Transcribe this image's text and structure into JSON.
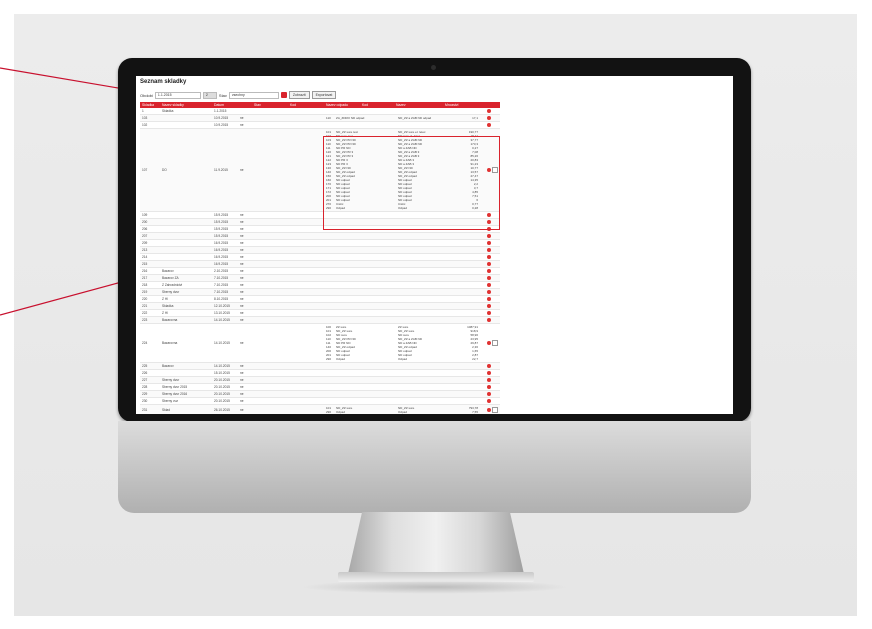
{
  "app": {
    "title": "Seznam skladky"
  },
  "filter": {
    "obdobi_label": "Obdobi",
    "obdobi_value": "1.1.2015",
    "count_value": "2",
    "typ_label": "Stav",
    "typ_value": "vsechny",
    "search_label": "Zobrazit",
    "export_label": "Exportovat"
  },
  "table": {
    "headers": [
      "Skladka",
      "Nazev skladky",
      "Datum",
      "Stav",
      "Kod",
      "Nazev odpadu",
      "Kod",
      "Nazev",
      "Mnozstvi"
    ],
    "rows": [
      {
        "id": "1",
        "name": "Skladka",
        "date": "1.1.2015",
        "flag": "",
        "items": []
      },
      {
        "id": "103",
        "name": "",
        "date": "10.9.2015",
        "flag": "ne",
        "items": [
          {
            "code": "110",
            "name": "ZA_ZDRO ND odpad",
            "cat": "ND_ZZ a ZAB ND odpad",
            "qty": "17,1"
          }
        ]
      },
      {
        "id": "102",
        "name": "",
        "date": "10.9.2015",
        "flag": "ne",
        "items": []
      },
      {
        "id": "107",
        "name": "DO",
        "date": "11.9.2015",
        "flag": "ne",
        "items": [
          {
            "code": "101",
            "name": "ND_ZZ sure text",
            "cat": "ND_ZZ sure el. letec",
            "qty": "190,77"
          },
          {
            "code": "102",
            "name": "ND sure text",
            "cat": "ND sure el. letec",
            "qty": "20,11"
          },
          {
            "code": "103",
            "name": "ND_ZZ PR ND",
            "cat": "ND_ZZ a ZAB ND",
            "qty": "37,77"
          },
          {
            "code": "110",
            "name": "ND_ZZ PR ND",
            "cat": "ND_ZZ a ZAB ND",
            "qty": "173,3"
          },
          {
            "code": "111",
            "name": "ND PR ND",
            "cat": "ND a ZAB ND",
            "qty": "0,27"
          },
          {
            "code": "120",
            "name": "ND_ZZ PR 3",
            "cat": "ND_ZZ a ZAB 3",
            "qty": "7,08"
          },
          {
            "code": "121",
            "name": "ND_ZZ PR 3",
            "cat": "ND_ZZ a ZAB 3",
            "qty": "85,26"
          },
          {
            "code": "122",
            "name": "ND PR 3",
            "cat": "ND a ZAB 3",
            "qty": "20,83"
          },
          {
            "code": "123",
            "name": "ND PR 3",
            "cat": "ND a ZAB 3",
            "qty": "91,23"
          },
          {
            "code": "130",
            "name": "ND_ZZ ND",
            "cat": "ND_ZZ ND",
            "qty": "10,77"
          },
          {
            "code": "140",
            "name": "ND_ZZ odpad",
            "cat": "ND_ZZ odpad",
            "qty": "13,57"
          },
          {
            "code": "150",
            "name": "ND_ZZ odpad",
            "cat": "ND_ZZ odpad",
            "qty": "27,47"
          },
          {
            "code": "160",
            "name": "ND odpad",
            "cat": "ND odpad",
            "qty": "14,35"
          },
          {
            "code": "170",
            "name": "ND odpad",
            "cat": "ND odpad",
            "qty": "2,2"
          },
          {
            "code": "171",
            "name": "ND odpad",
            "cat": "ND odpad",
            "qty": "3,7"
          },
          {
            "code": "172",
            "name": "ND odpad",
            "cat": "ND odpad",
            "qty": "4,85"
          },
          {
            "code": "200",
            "name": "ND odpad",
            "cat": "ND odpad",
            "qty": "7,51"
          },
          {
            "code": "201",
            "name": "ND odpad",
            "cat": "ND odpad",
            "qty": "6"
          },
          {
            "code": "270",
            "name": "Cistic",
            "cat": "Cistic",
            "qty": "0,77"
          },
          {
            "code": "290",
            "name": "Odpad",
            "cat": "Odpad",
            "qty": "0,28"
          }
        ]
      },
      {
        "id": "109",
        "name": "",
        "date": "15.9.2015",
        "flag": "ne",
        "items": []
      },
      {
        "id": "200",
        "name": "",
        "date": "15.9.2015",
        "flag": "ne",
        "items": []
      },
      {
        "id": "206",
        "name": "",
        "date": "15.9.2015",
        "flag": "ne",
        "items": []
      },
      {
        "id": "207",
        "name": "",
        "date": "15.9.2015",
        "flag": "ne",
        "items": []
      },
      {
        "id": "209",
        "name": "",
        "date": "16.9.2015",
        "flag": "ne",
        "items": []
      },
      {
        "id": "213",
        "name": "",
        "date": "16.9.2015",
        "flag": "ne",
        "items": []
      },
      {
        "id": "214",
        "name": "",
        "date": "16.9.2015",
        "flag": "ne",
        "items": []
      },
      {
        "id": "215",
        "name": "",
        "date": "16.9.2015",
        "flag": "ne",
        "items": []
      },
      {
        "id": "216",
        "name": "Bazarov",
        "date": "2.10.2015",
        "flag": "ne",
        "items": []
      },
      {
        "id": "217",
        "name": "Bazarov ZA",
        "date": "7.10.2015",
        "flag": "ne",
        "items": []
      },
      {
        "id": "218",
        "name": "Z Zahradnictvi",
        "date": "7.10.2015",
        "flag": "ne",
        "items": []
      },
      {
        "id": "219",
        "name": "Sberny dvur",
        "date": "7.10.2015",
        "flag": "ne",
        "items": []
      },
      {
        "id": "220",
        "name": "Z Hl",
        "date": "8.10.2015",
        "flag": "ne",
        "items": []
      },
      {
        "id": "221",
        "name": "Skladka",
        "date": "12.10.2015",
        "flag": "ne",
        "items": []
      },
      {
        "id": "222",
        "name": "Z Hl",
        "date": "13.10.2015",
        "flag": "ne",
        "items": []
      },
      {
        "id": "223",
        "name": "Bazarovna",
        "date": "14.10.2015",
        "flag": "ne",
        "items": []
      },
      {
        "id": "224",
        "name": "Bazarovna",
        "date": "14.10.2015",
        "flag": "ne",
        "items": [
          {
            "code": "100",
            "name": "ZZ sure",
            "cat": "ZZ sure",
            "qty": "1087,91"
          },
          {
            "code": "101",
            "name": "ND_ZZ sure",
            "cat": "ND_ZZ sure",
            "qty": "918,9"
          },
          {
            "code": "102",
            "name": "ND sure",
            "cat": "ND sure",
            "qty": "58,96"
          },
          {
            "code": "110",
            "name": "ND_ZZ PR ND",
            "cat": "ND_ZZ a ZAB ND",
            "qty": "23,95"
          },
          {
            "code": "111",
            "name": "ND PR ND",
            "cat": "ND a ZAB ND",
            "qty": "29,87"
          },
          {
            "code": "140",
            "name": "ND_ZZ odpad",
            "cat": "ND_ZZ odpad",
            "qty": "2,36"
          },
          {
            "code": "200",
            "name": "ND odpad",
            "cat": "ND odpad",
            "qty": "1,65"
          },
          {
            "code": "201",
            "name": "ND odpad",
            "cat": "ND odpad",
            "qty": "2,87"
          },
          {
            "code": "290",
            "name": "Odpad",
            "cat": "Odpad",
            "qty": "22,7"
          }
        ]
      },
      {
        "id": "225",
        "name": "Bazarov",
        "date": "14.10.2015",
        "flag": "ne",
        "items": []
      },
      {
        "id": "226",
        "name": "",
        "date": "15.10.2015",
        "flag": "ne",
        "items": []
      },
      {
        "id": "227",
        "name": "Sberny dvur",
        "date": "20.10.2015",
        "flag": "ne",
        "items": []
      },
      {
        "id": "228",
        "name": "Sberny dvur 2015",
        "date": "20.10.2015",
        "flag": "ne",
        "items": []
      },
      {
        "id": "229",
        "name": "Sberny dvur 2016",
        "date": "20.10.2015",
        "flag": "ne",
        "items": []
      },
      {
        "id": "230",
        "name": "Sberny vuz",
        "date": "20.10.2015",
        "flag": "ne",
        "items": []
      },
      {
        "id": "231",
        "name": "Sklad",
        "date": "26.10.2015",
        "flag": "ne",
        "items": [
          {
            "code": "101",
            "name": "ND_ZZ sure",
            "cat": "ND_ZZ sure",
            "qty": "793,78"
          },
          {
            "code": "290",
            "name": "Odpad",
            "cat": "Odpad",
            "qty": "7,55"
          }
        ]
      },
      {
        "id": "232",
        "name": "",
        "date": "1.10.2015",
        "flag": "ne",
        "items": []
      },
      {
        "id": "233",
        "name": "Odpad",
        "date": "1.10.2015",
        "flag": "ne",
        "items": [
          {
            "code": "101",
            "name": "ND_ZZ sure",
            "cat": "ND_ZZ sure",
            "qty": "86,91"
          },
          {
            "code": "102",
            "name": "ND sure",
            "cat": "ND sure",
            "qty": "10,72"
          },
          {
            "code": "110",
            "name": "ND_ZZ PR ND",
            "cat": "ND_ZZ a ZAB ND",
            "qty": "22,95"
          }
        ]
      }
    ]
  },
  "colors": {
    "accent": "#d9232d",
    "bezel": "#121212"
  }
}
